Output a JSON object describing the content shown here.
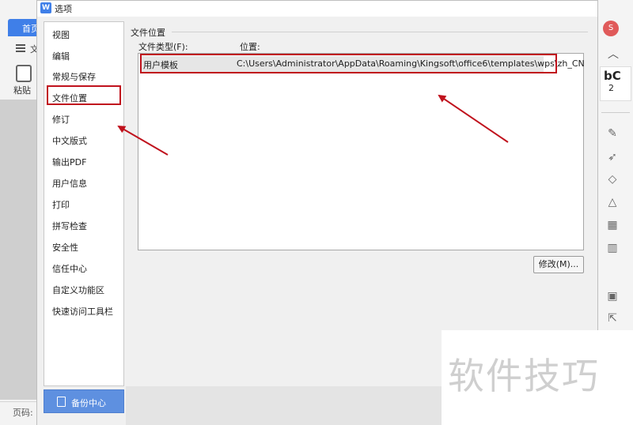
{
  "background_app": {
    "home_tab": "首页",
    "menu_label": "文",
    "paste_label": "粘贴",
    "status_text": "页码:",
    "avatar_text": "S",
    "style_preview": "bC",
    "style_sub": "2"
  },
  "dialog": {
    "title": "选项",
    "nav_items": [
      "视图",
      "编辑",
      "常规与保存",
      "文件位置",
      "修订",
      "中文版式",
      "输出PDF",
      "用户信息",
      "打印",
      "拼写检查",
      "安全性",
      "信任中心",
      "自定义功能区",
      "快速访问工具栏"
    ],
    "selected_nav": "文件位置",
    "backup_button": "备份中心",
    "group_title": "文件位置",
    "col_type": "文件类型(F):",
    "col_location": "位置:",
    "rows": [
      {
        "type": "用户模板",
        "path": "C:\\Users\\Administrator\\AppData\\Roaming\\Kingsoft\\office6\\templates\\wps\\zh_CN"
      }
    ],
    "modify_button": "修改(M)..."
  },
  "watermark": "软件技巧",
  "colors": {
    "accent_blue": "#3f7fe8",
    "annotation_red": "#c0121d",
    "backup_button": "#5e90e0"
  }
}
